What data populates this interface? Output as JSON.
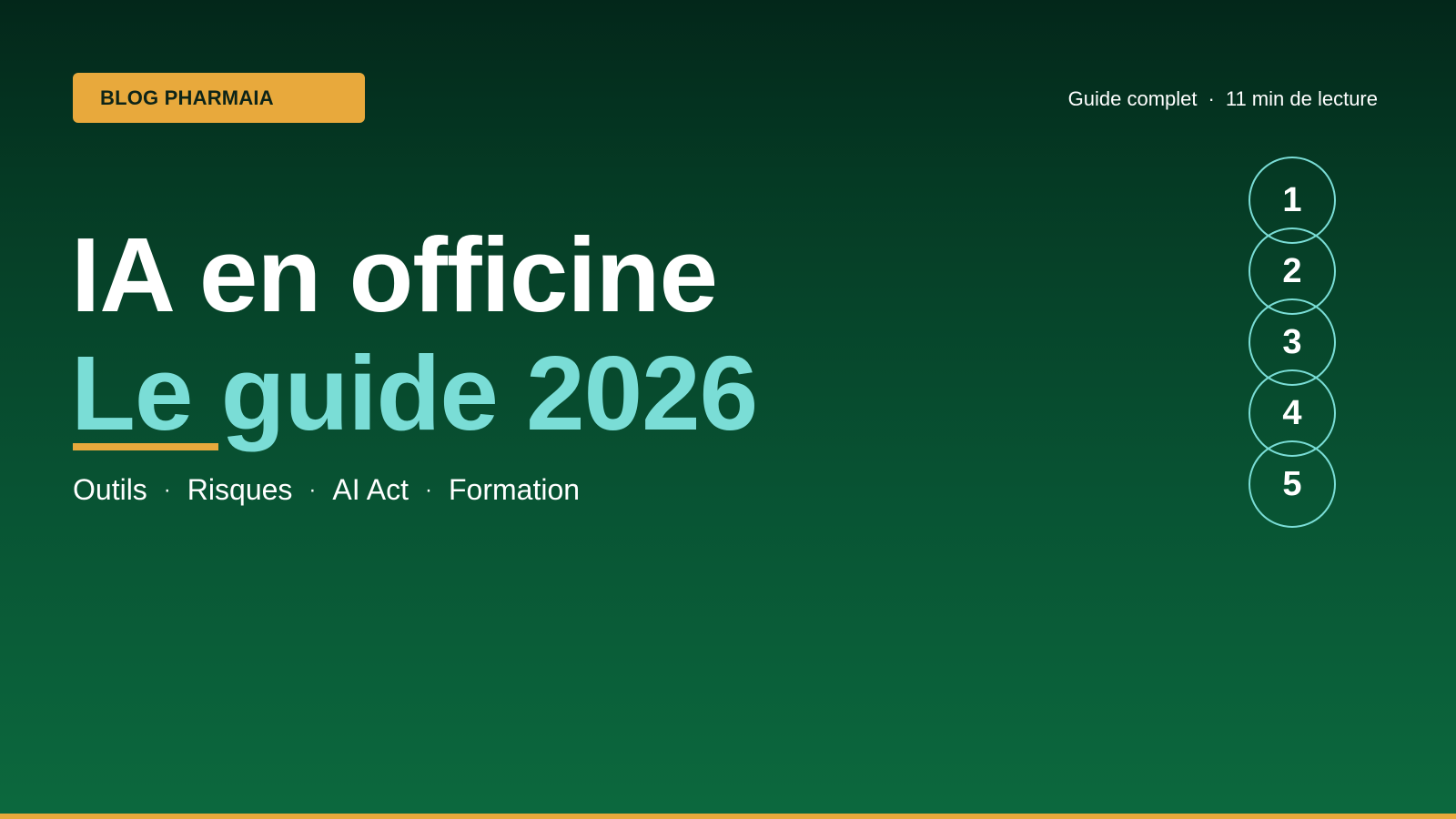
{
  "badge": {
    "label": "BLOG PHARMAIA"
  },
  "meta": {
    "type": "Guide complet",
    "separator": "·",
    "reading_time": "11 min de lecture"
  },
  "title": {
    "line1": "IA en officine",
    "line2": "Le guide 2026"
  },
  "topics": [
    "Outils",
    "Risques",
    "AI Act",
    "Formation"
  ],
  "topic_separator": "·",
  "steps": [
    "1",
    "2",
    "3",
    "4",
    "5"
  ],
  "colors": {
    "background_top": "#03271a",
    "background_bottom": "#0c693e",
    "accent_gold": "#e8a93c",
    "accent_teal": "#7addd6",
    "text_light": "#ffffff",
    "badge_text": "#0d2418"
  }
}
